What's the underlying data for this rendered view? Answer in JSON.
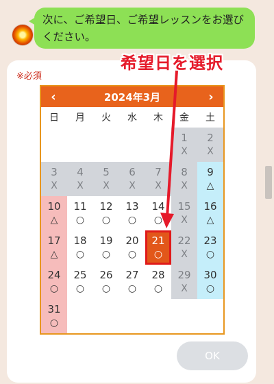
{
  "chat": {
    "message": "次に、ご希望日、ご希望レッスンをお選びください。"
  },
  "form": {
    "required_label": "※必須",
    "ok_label": "OK"
  },
  "annotation": {
    "label": "希望日を選択"
  },
  "calendar": {
    "title": "2024年3月",
    "prev": "‹",
    "next": "›",
    "weekdays": [
      "日",
      "月",
      "火",
      "水",
      "木",
      "金",
      "土"
    ],
    "weeks": [
      [
        {
          "day": "",
          "mark": "",
          "type": "empty"
        },
        {
          "day": "",
          "mark": "",
          "type": "empty"
        },
        {
          "day": "",
          "mark": "",
          "type": "empty"
        },
        {
          "day": "",
          "mark": "",
          "type": "empty"
        },
        {
          "day": "",
          "mark": "",
          "type": "empty"
        },
        {
          "day": "1",
          "mark": "X",
          "type": "past"
        },
        {
          "day": "2",
          "mark": "X",
          "type": "past"
        }
      ],
      [
        {
          "day": "3",
          "mark": "X",
          "type": "past"
        },
        {
          "day": "4",
          "mark": "X",
          "type": "past"
        },
        {
          "day": "5",
          "mark": "X",
          "type": "past"
        },
        {
          "day": "6",
          "mark": "X",
          "type": "past"
        },
        {
          "day": "7",
          "mark": "X",
          "type": "past"
        },
        {
          "day": "8",
          "mark": "X",
          "type": "past"
        },
        {
          "day": "9",
          "mark": "△",
          "type": "sat"
        }
      ],
      [
        {
          "day": "10",
          "mark": "△",
          "type": "sun"
        },
        {
          "day": "11",
          "mark": "○",
          "type": "open"
        },
        {
          "day": "12",
          "mark": "○",
          "type": "open"
        },
        {
          "day": "13",
          "mark": "○",
          "type": "open"
        },
        {
          "day": "14",
          "mark": "○",
          "type": "open"
        },
        {
          "day": "15",
          "mark": "X",
          "type": "past"
        },
        {
          "day": "16",
          "mark": "△",
          "type": "sat"
        }
      ],
      [
        {
          "day": "17",
          "mark": "△",
          "type": "sun"
        },
        {
          "day": "18",
          "mark": "○",
          "type": "open"
        },
        {
          "day": "19",
          "mark": "○",
          "type": "open"
        },
        {
          "day": "20",
          "mark": "○",
          "type": "open"
        },
        {
          "day": "21",
          "mark": "○",
          "type": "selected"
        },
        {
          "day": "22",
          "mark": "X",
          "type": "past"
        },
        {
          "day": "23",
          "mark": "○",
          "type": "sat"
        }
      ],
      [
        {
          "day": "24",
          "mark": "○",
          "type": "sun"
        },
        {
          "day": "25",
          "mark": "○",
          "type": "open"
        },
        {
          "day": "26",
          "mark": "○",
          "type": "open"
        },
        {
          "day": "27",
          "mark": "○",
          "type": "open"
        },
        {
          "day": "28",
          "mark": "○",
          "type": "open"
        },
        {
          "day": "29",
          "mark": "X",
          "type": "past"
        },
        {
          "day": "30",
          "mark": "○",
          "type": "sat"
        }
      ],
      [
        {
          "day": "31",
          "mark": "○",
          "type": "sun"
        },
        {
          "day": "",
          "mark": "",
          "type": "empty"
        },
        {
          "day": "",
          "mark": "",
          "type": "empty"
        },
        {
          "day": "",
          "mark": "",
          "type": "empty"
        },
        {
          "day": "",
          "mark": "",
          "type": "empty"
        },
        {
          "day": "",
          "mark": "",
          "type": "empty"
        },
        {
          "day": "",
          "mark": "",
          "type": "empty"
        }
      ]
    ]
  },
  "colors": {
    "chat_bubble": "#8de055",
    "header": "#e8631c",
    "border": "#e8961e",
    "selected": "#e2571a",
    "annotation": "#e51a2a",
    "sunday": "#f6bcbb",
    "saturday": "#c5eefa",
    "past": "#d2d5da"
  }
}
